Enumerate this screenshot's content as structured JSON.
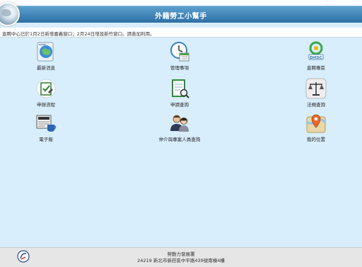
{
  "header": {
    "title": "外籍勞工小幫手"
  },
  "marquee": {
    "text": "直聘中心已於1月2日新增嘉義窗口；2月24日增設新竹窗口。請善加利用。"
  },
  "items": [
    {
      "label": "最新消息",
      "icon": "news-globe-icon"
    },
    {
      "label": "管理事項",
      "icon": "clock-calendar-icon"
    },
    {
      "label": "直聘專區",
      "icon": "dhsc-logo-icon"
    },
    {
      "label": "申辦流程",
      "icon": "checklist-icon"
    },
    {
      "label": "申請查詢",
      "icon": "document-search-icon"
    },
    {
      "label": "法規查詢",
      "icon": "scales-icon"
    },
    {
      "label": "電子報",
      "icon": "newspaper-icon"
    },
    {
      "label": "仲介與專案人員查詢",
      "icon": "people-icon"
    },
    {
      "label": "我的位置",
      "icon": "map-pin-icon"
    }
  ],
  "footer": {
    "org": "勞動力發展署",
    "address": "24219 新北市新莊區中平路439號南棟4樓"
  },
  "colors": {
    "header": "#2c6fa5",
    "background": "#d8eefc"
  }
}
